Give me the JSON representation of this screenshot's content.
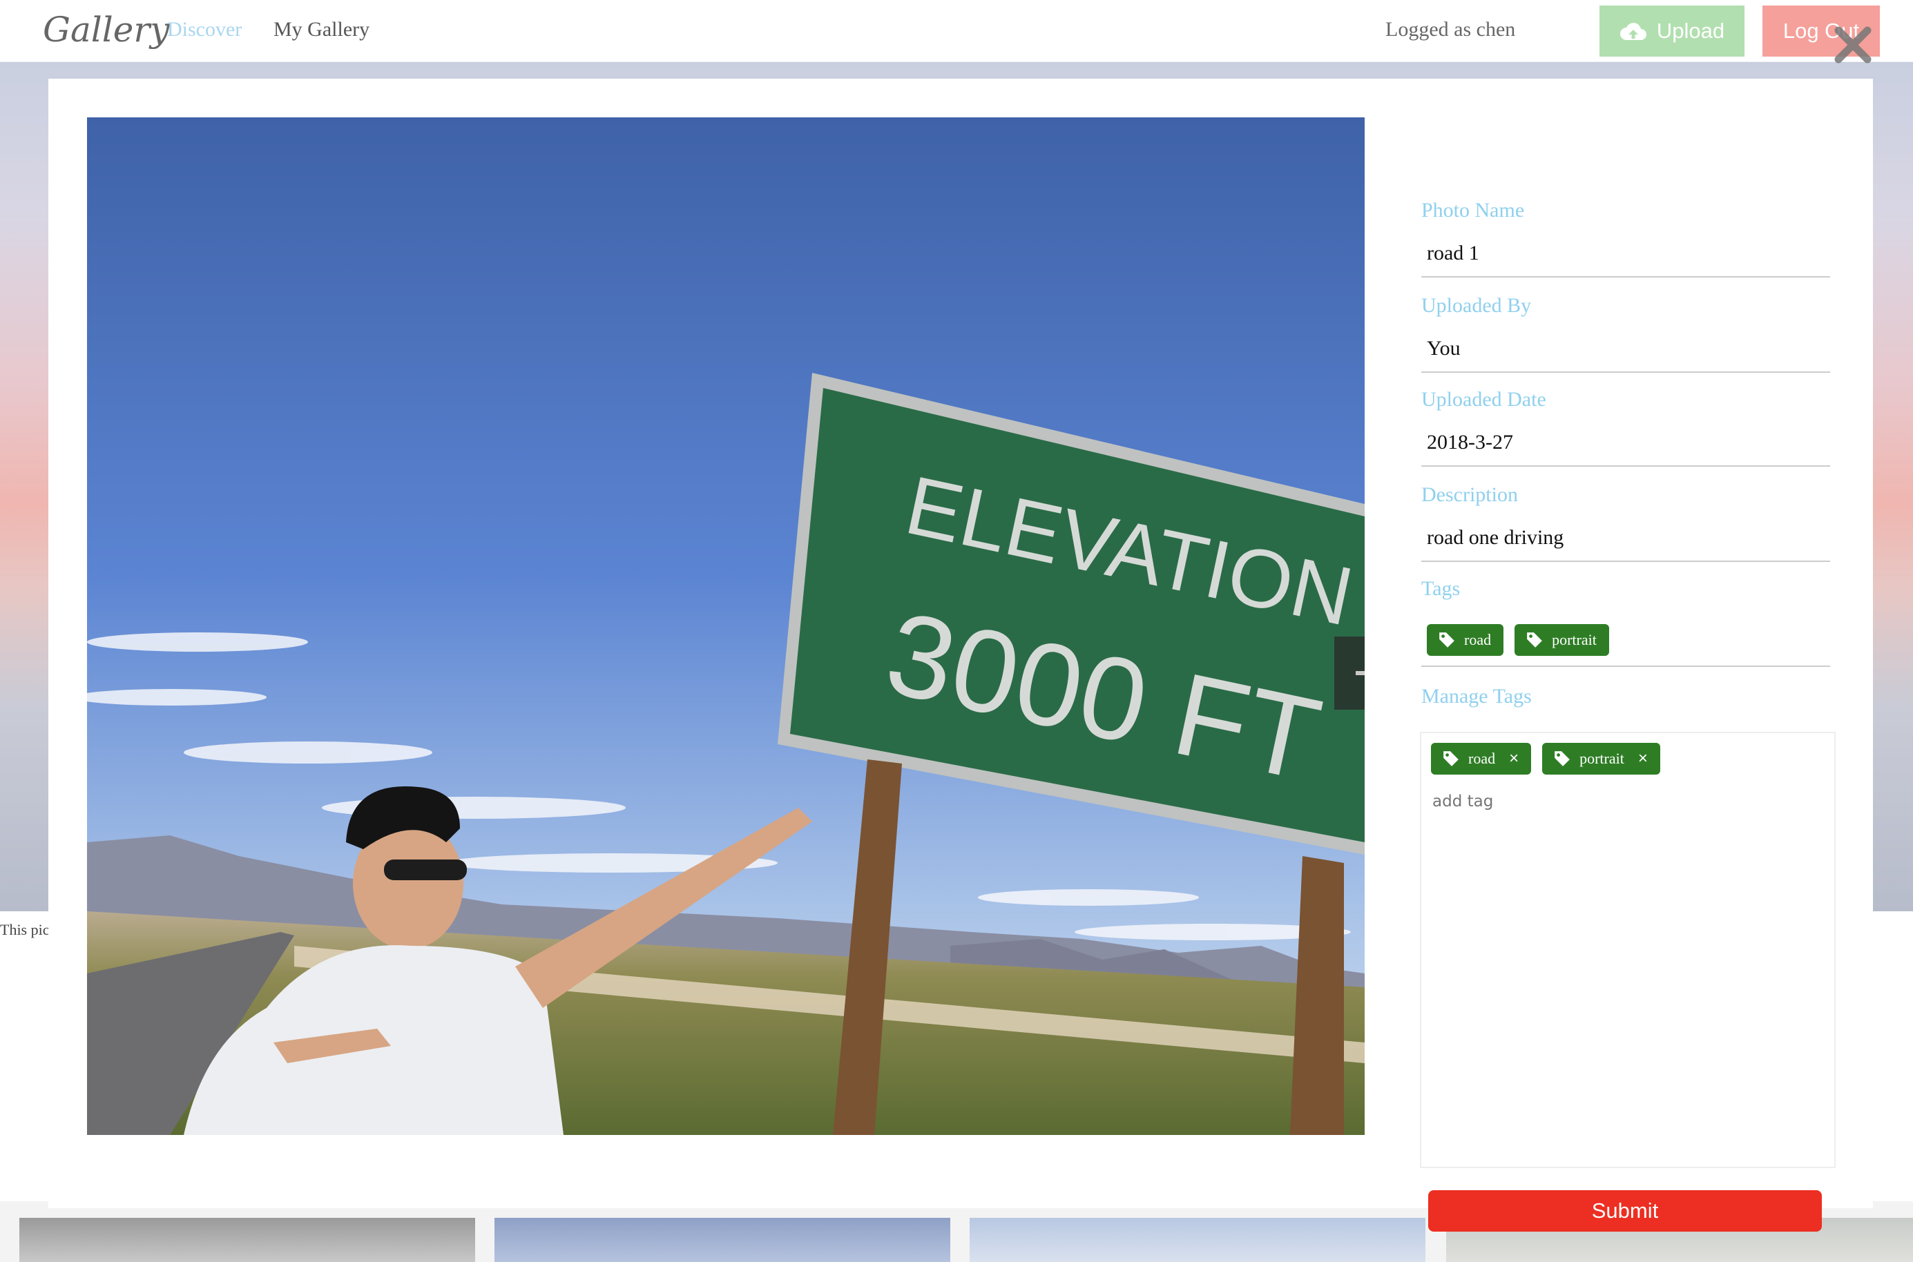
{
  "navbar": {
    "brand": "Gallery",
    "links": [
      "Discover",
      "My Gallery"
    ],
    "logged_text": "Logged as chen",
    "upload_label": "Upload",
    "logout_label": "Log Out"
  },
  "background": {
    "caption": "This pic"
  },
  "modal": {
    "fields": {
      "photo_name_label": "Photo Name",
      "photo_name": "road 1",
      "uploaded_by_label": "Uploaded By",
      "uploaded_by": "You",
      "uploaded_date_label": "Uploaded Date",
      "uploaded_date": "2018-3-27",
      "description_label": "Description",
      "description": "road one driving",
      "tags_label": "Tags",
      "manage_tags_label": "Manage Tags"
    },
    "tags": [
      "road",
      "portrait"
    ],
    "manage_tags": [
      "road",
      "portrait"
    ],
    "add_tag_placeholder": "add tag",
    "submit_label": "Submit",
    "photo": {
      "sign_line1": "ELEVATION",
      "sign_line2": "3000 FT"
    }
  },
  "colors": {
    "accent_label": "#8fd0ee",
    "tag_green": "#2e7d25",
    "submit_red": "#ec2f22",
    "upload_green": "#b2dfb0",
    "logout_red": "#f5a09a"
  }
}
